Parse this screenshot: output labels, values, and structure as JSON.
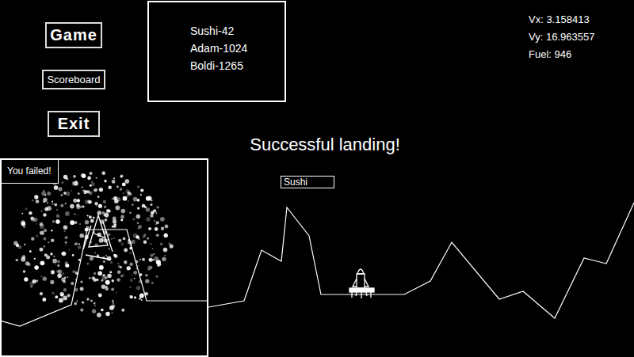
{
  "menu": {
    "buttons": [
      {
        "label": "Game",
        "size": "large"
      },
      {
        "label": "Scoreboard",
        "size": "small"
      },
      {
        "label": "Exit",
        "size": "large"
      }
    ]
  },
  "scoreboard": {
    "entries": [
      "Sushi-42",
      "Adam-1024",
      "Boldi-1265"
    ]
  },
  "hud": {
    "lines": [
      "Vx: 3.158413",
      "Vy: 16.963557",
      "Fuel: 946"
    ]
  },
  "message": "Successful landing!",
  "name_input": {
    "value": "Sushi"
  },
  "inset": {
    "label": "You failed!"
  }
}
